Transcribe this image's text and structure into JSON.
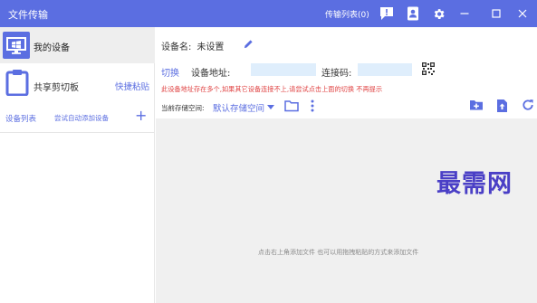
{
  "app": {
    "title": "文件传输",
    "transfer_list": "传输列表(0)"
  },
  "sidebar": {
    "my_device": "我的设备",
    "clipboard": "共享剪切板",
    "quick_paste": "快捷粘贴",
    "device_list": "设备列表",
    "auto_add": "尝试自动添加设备",
    "plus": "+"
  },
  "main": {
    "device_name_label": "设备名:",
    "device_name_value": "未设置",
    "switch": "切换",
    "address_label": "设备地址:",
    "code_label": "连接码:",
    "warning": "此设备地址存在多个,如果其它设备连接不上,请尝试点击上面的切换    不再提示",
    "storage_label": "当前存储空间:",
    "storage_value": "默认存储空间",
    "empty_hint": "点击右上角添加文件 也可以用拖拽粘贴的方式来添加文件"
  },
  "watermark": "最需网",
  "colors": {
    "accent": "#5b6ee1",
    "warning": "#e04545",
    "file_area": "#f0f0f0"
  }
}
